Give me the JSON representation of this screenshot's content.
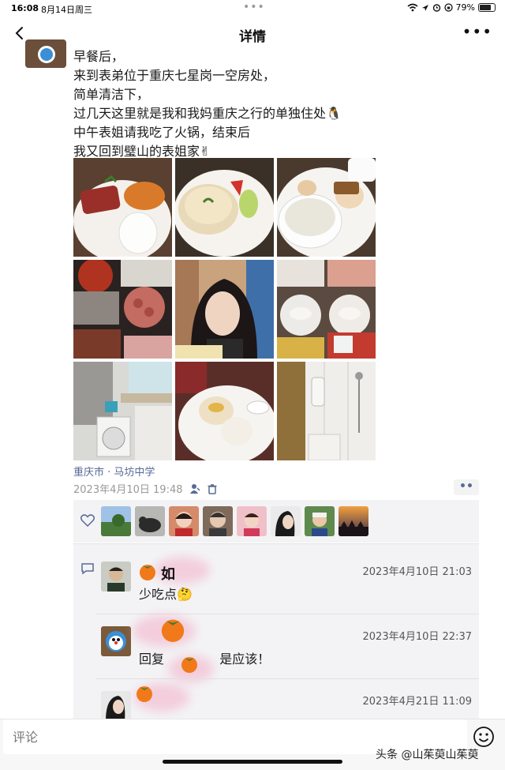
{
  "status_bar": {
    "time": "16:08",
    "date": "8月14日周三",
    "battery": "79%",
    "battery_level": 0.79
  },
  "nav": {
    "title": "详情",
    "back_icon": "chevron-left-icon",
    "more_icon": "more-horizontal-icon"
  },
  "post": {
    "lines": [
      "早餐后，",
      "来到表弟位于重庆七星岗一空房处，",
      "简单清洁下，",
      "过几天这里就是我和我妈重庆之行的单独住处🐧",
      "中午表姐请我吃了火锅，结束后",
      "我又回到璧山的表姐家✌"
    ],
    "photos": [
      "breakfast-ham-bun",
      "steamed-bun-fruit",
      "rice-porridge-eggs",
      "hotpot-collage",
      "selfie-woman",
      "dumplings-collage",
      "kitchen-washing-machine",
      "egg-bun-plate",
      "bathroom-shower"
    ],
    "location": "重庆市 · 马坊中学",
    "datetime": "2023年4月10日 19:48"
  },
  "likes": {
    "icon": "heart-icon",
    "count": 8
  },
  "comments": [
    {
      "name_visible": "如",
      "time": "2023年4月10日 21:03",
      "text": "少吃点🤔"
    },
    {
      "name_visible": "",
      "time": "2023年4月10日 22:37",
      "text": "回复",
      "reply_tail": "是应该！"
    },
    {
      "name_visible": "",
      "time": "2023年4月21日 11:09",
      "text": ""
    }
  ],
  "comment_bar": {
    "placeholder": "评论",
    "emoji_icon": "smiley-icon"
  },
  "watermark": "头条 @山茱萸山茱萸"
}
